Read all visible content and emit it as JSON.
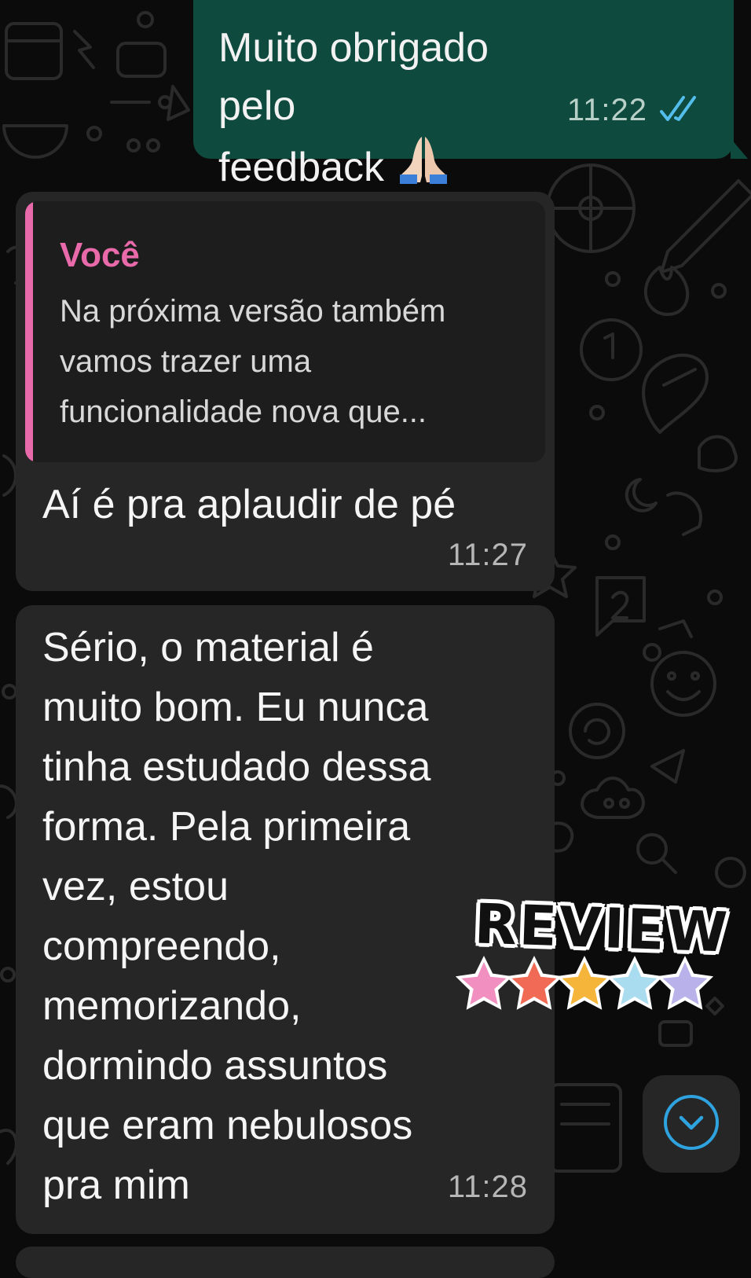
{
  "messages": [
    {
      "direction": "outgoing",
      "text": "Muito obrigado pelo\nfeedback",
      "emoji": "folded-hands",
      "time": "11:22",
      "status": "read"
    },
    {
      "direction": "incoming",
      "quote": {
        "author": "Você",
        "text": "Na próxima versão também\nvamos trazer uma\nfuncionalidade nova que..."
      },
      "text": "Aí é pra aplaudir de pé",
      "time": "11:27"
    },
    {
      "direction": "incoming",
      "text": "Sério, o material é\nmuito bom. Eu nunca\ntinha estudado dessa\nforma. Pela primeira\nvez, estou\ncompreendo,\nmemorizando,\ndormindo assuntos\nque eram nebulosos\npra mim",
      "time": "11:28"
    }
  ],
  "sticker": {
    "text": "REVIEW",
    "stars": 5,
    "star_colors": [
      "#f08fc0",
      "#f06a55",
      "#f5b43a",
      "#a9dcef",
      "#b9b2ea"
    ]
  },
  "scroll_button": {
    "icon": "chevron-down-icon"
  },
  "colors": {
    "outgoing_bubble": "#0f4a3f",
    "incoming_bubble": "#262626",
    "quote_accent": "#e96aab",
    "read_ticks": "#53bdeb",
    "background": "#0b0b0b"
  }
}
